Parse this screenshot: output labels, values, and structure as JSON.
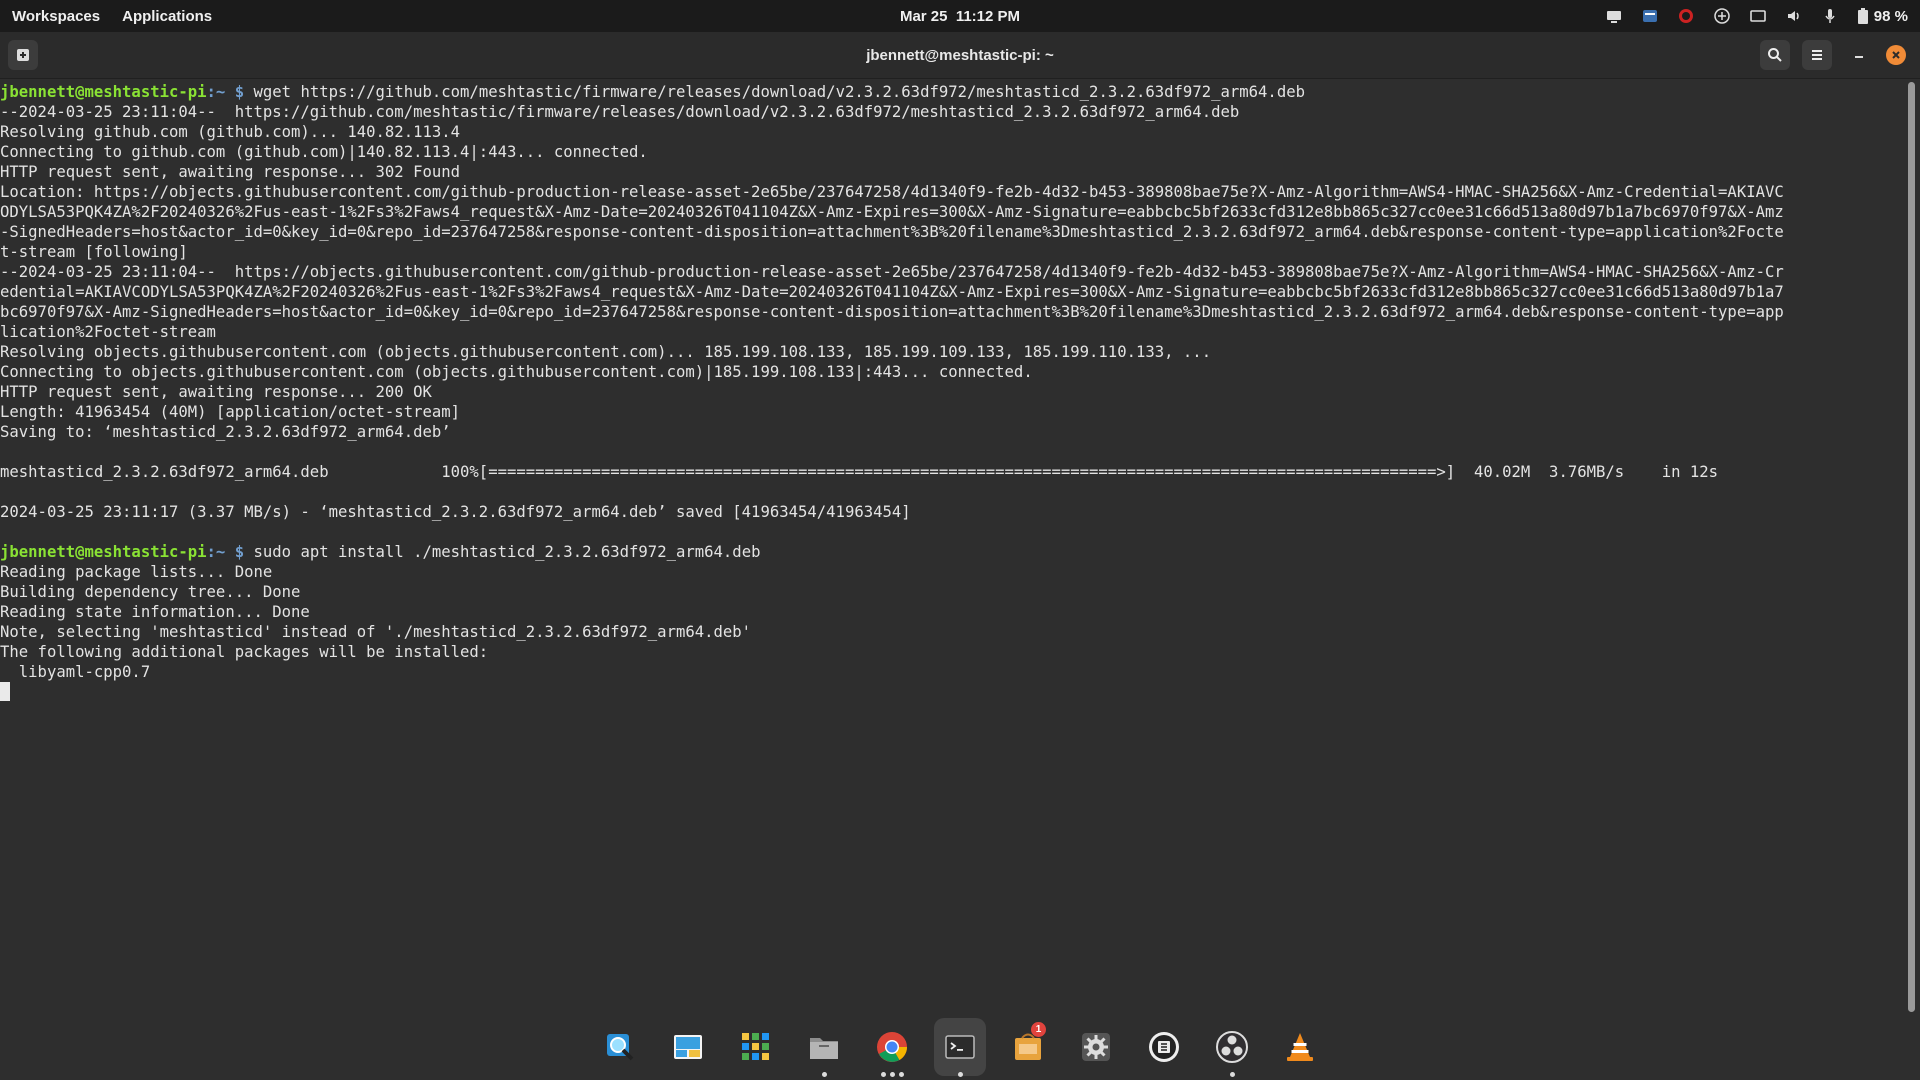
{
  "topbar": {
    "workspaces": "Workspaces",
    "applications": "Applications",
    "date": "Mar 25",
    "time": "11:12 PM",
    "battery": "98 %"
  },
  "window": {
    "title": "jbennett@meshtastic-pi: ~"
  },
  "terminal": {
    "prompt_user": "jbennett@meshtastic-pi",
    "prompt_path": ":~",
    "prompt_symbol": " $ ",
    "cmd1": "wget https://github.com/meshtastic/firmware/releases/download/v2.3.2.63df972/meshtasticd_2.3.2.63df972_arm64.deb",
    "out1": [
      "--2024-03-25 23:11:04--  https://github.com/meshtastic/firmware/releases/download/v2.3.2.63df972/meshtasticd_2.3.2.63df972_arm64.deb",
      "Resolving github.com (github.com)... 140.82.113.4",
      "Connecting to github.com (github.com)|140.82.113.4|:443... connected.",
      "HTTP request sent, awaiting response... 302 Found",
      "Location: https://objects.githubusercontent.com/github-production-release-asset-2e65be/237647258/4d1340f9-fe2b-4d32-b453-389808bae75e?X-Amz-Algorithm=AWS4-HMAC-SHA256&X-Amz-Credential=AKIAVC",
      "ODYLSA53PQK4ZA%2F20240326%2Fus-east-1%2Fs3%2Faws4_request&X-Amz-Date=20240326T041104Z&X-Amz-Expires=300&X-Amz-Signature=eabbcbc5bf2633cfd312e8bb865c327cc0ee31c66d513a80d97b1a7bc6970f97&X-Amz",
      "-SignedHeaders=host&actor_id=0&key_id=0&repo_id=237647258&response-content-disposition=attachment%3B%20filename%3Dmeshtasticd_2.3.2.63df972_arm64.deb&response-content-type=application%2Focte",
      "t-stream [following]",
      "--2024-03-25 23:11:04--  https://objects.githubusercontent.com/github-production-release-asset-2e65be/237647258/4d1340f9-fe2b-4d32-b453-389808bae75e?X-Amz-Algorithm=AWS4-HMAC-SHA256&X-Amz-Cr",
      "edential=AKIAVCODYLSA53PQK4ZA%2F20240326%2Fus-east-1%2Fs3%2Faws4_request&X-Amz-Date=20240326T041104Z&X-Amz-Expires=300&X-Amz-Signature=eabbcbc5bf2633cfd312e8bb865c327cc0ee31c66d513a80d97b1a7",
      "bc6970f97&X-Amz-SignedHeaders=host&actor_id=0&key_id=0&repo_id=237647258&response-content-disposition=attachment%3B%20filename%3Dmeshtasticd_2.3.2.63df972_arm64.deb&response-content-type=app",
      "lication%2Foctet-stream",
      "Resolving objects.githubusercontent.com (objects.githubusercontent.com)... 185.199.108.133, 185.199.109.133, 185.199.110.133, ...",
      "Connecting to objects.githubusercontent.com (objects.githubusercontent.com)|185.199.108.133|:443... connected.",
      "HTTP request sent, awaiting response... 200 OK",
      "Length: 41963454 (40M) [application/octet-stream]",
      "Saving to: ‘meshtasticd_2.3.2.63df972_arm64.deb’",
      "",
      "meshtasticd_2.3.2.63df972_arm64.deb            100%[=====================================================================================================>]  40.02M  3.76MB/s    in 12s",
      "",
      "2024-03-25 23:11:17 (3.37 MB/s) - ‘meshtasticd_2.3.2.63df972_arm64.deb’ saved [41963454/41963454]",
      ""
    ],
    "cmd2": "sudo apt install ./meshtasticd_2.3.2.63df972_arm64.deb",
    "out2": [
      "Reading package lists... Done",
      "Building dependency tree... Done",
      "Reading state information... Done",
      "Note, selecting 'meshtasticd' instead of './meshtasticd_2.3.2.63df972_arm64.deb'",
      "The following additional packages will be installed:",
      "  libyaml-cpp0.7"
    ]
  },
  "dock": {
    "items": [
      {
        "name": "magnifier-app",
        "icon": "magnifier-icon"
      },
      {
        "name": "photo-viewer-app",
        "icon": "photo-icon"
      },
      {
        "name": "app-grid",
        "icon": "grid-icon"
      },
      {
        "name": "files-app",
        "icon": "folder-icon"
      },
      {
        "name": "chrome-app",
        "icon": "chrome-icon"
      },
      {
        "name": "terminal-app",
        "icon": "terminal-icon"
      },
      {
        "name": "software-center-app",
        "icon": "store-icon",
        "badge": "1"
      },
      {
        "name": "settings-app",
        "icon": "gear-icon"
      },
      {
        "name": "ble-app",
        "icon": "ble-icon"
      },
      {
        "name": "obs-app",
        "icon": "obs-icon"
      },
      {
        "name": "vlc-app",
        "icon": "vlc-icon"
      }
    ]
  },
  "colors": {
    "prompt_user": "#8ae234",
    "prompt_path": "#729fcf",
    "close_button": "#f08b37",
    "background": "#2e2e2e"
  }
}
